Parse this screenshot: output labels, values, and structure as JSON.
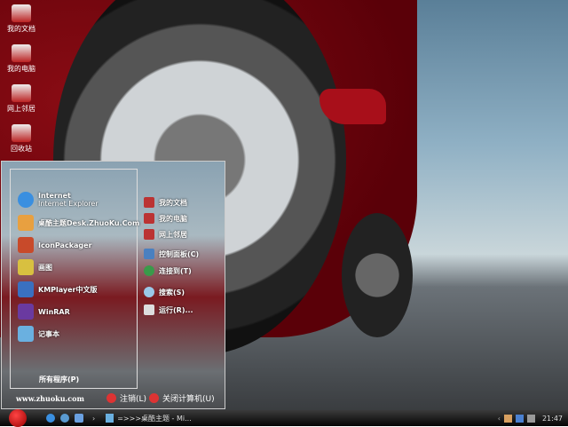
{
  "desktop": {
    "icons": [
      {
        "label": "我的文档"
      },
      {
        "label": "我的电脑"
      },
      {
        "label": "网上邻居"
      },
      {
        "label": "回收站"
      }
    ]
  },
  "start_menu": {
    "programs": [
      {
        "title": "Internet",
        "subtitle": "Internet Explorer",
        "icon": "ie-icon",
        "color": "#3a8fe0"
      },
      {
        "title": "桌酷主题Desk.ZhuoKu.Com",
        "icon": "theme-icon",
        "color": "#e8a040"
      },
      {
        "title": "IconPackager",
        "icon": "iconpackager-icon",
        "color": "#c84a2a"
      },
      {
        "title": "画图",
        "icon": "paint-icon",
        "color": "#d8c040"
      },
      {
        "title": "KMPlayer中文版",
        "icon": "kmplayer-icon",
        "color": "#3a70c0"
      },
      {
        "title": "WinRAR",
        "icon": "winrar-icon",
        "color": "#6a3aa0"
      },
      {
        "title": "记事本",
        "icon": "notepad-icon",
        "color": "#6ab0e0"
      }
    ],
    "all_programs": "所有程序(P)",
    "places": [
      {
        "label": "我的文档"
      },
      {
        "label": "我的电脑"
      },
      {
        "label": "网上邻居"
      },
      {
        "label": "控制面板(C)"
      },
      {
        "label": "连接到(T)"
      },
      {
        "label": "搜索(S)"
      },
      {
        "label": "运行(R)..."
      }
    ],
    "website": "www.zhuoku.com",
    "logoff": "注销(L)",
    "shutdown": "关闭计算机(U)"
  },
  "taskbar": {
    "task": "=>>>桌酷主题 - Mi...",
    "clock": "21:47",
    "chevron": "›",
    "tray_chevron": "‹"
  }
}
